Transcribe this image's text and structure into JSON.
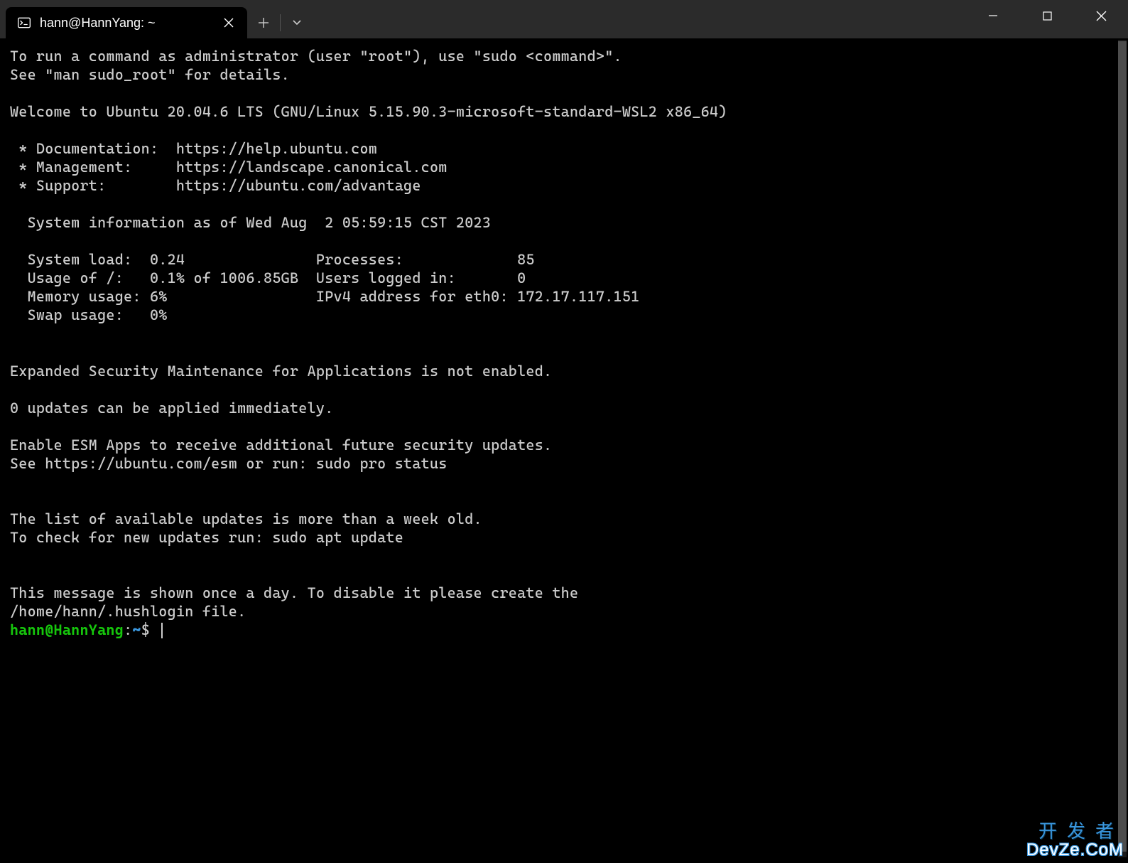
{
  "titlebar": {
    "tab_title": "hann@HannYang: ~"
  },
  "terminal": {
    "motd": "To run a command as administrator (user \"root\"), use \"sudo <command>\".\nSee \"man sudo_root\" for details.\n\nWelcome to Ubuntu 20.04.6 LTS (GNU/Linux 5.15.90.3-microsoft-standard-WSL2 x86_64)\n\n * Documentation:  https://help.ubuntu.com\n * Management:     https://landscape.canonical.com\n * Support:        https://ubuntu.com/advantage\n\n  System information as of Wed Aug  2 05:59:15 CST 2023\n\n  System load:  0.24               Processes:             85\n  Usage of /:   0.1% of 1006.85GB  Users logged in:       0\n  Memory usage: 6%                 IPv4 address for eth0: 172.17.117.151\n  Swap usage:   0%\n\n\nExpanded Security Maintenance for Applications is not enabled.\n\n0 updates can be applied immediately.\n\nEnable ESM Apps to receive additional future security updates.\nSee https://ubuntu.com/esm or run: sudo pro status\n\n\nThe list of available updates is more than a week old.\nTo check for new updates run: sudo apt update\n\n\nThis message is shown once a day. To disable it please create the\n/home/hann/.hushlogin file.",
    "prompt_user": "hann@HannYang",
    "prompt_path": "~",
    "prompt_symbol": "$"
  },
  "watermark": {
    "line1": "开发者",
    "line2": "DevZe.CoM"
  }
}
